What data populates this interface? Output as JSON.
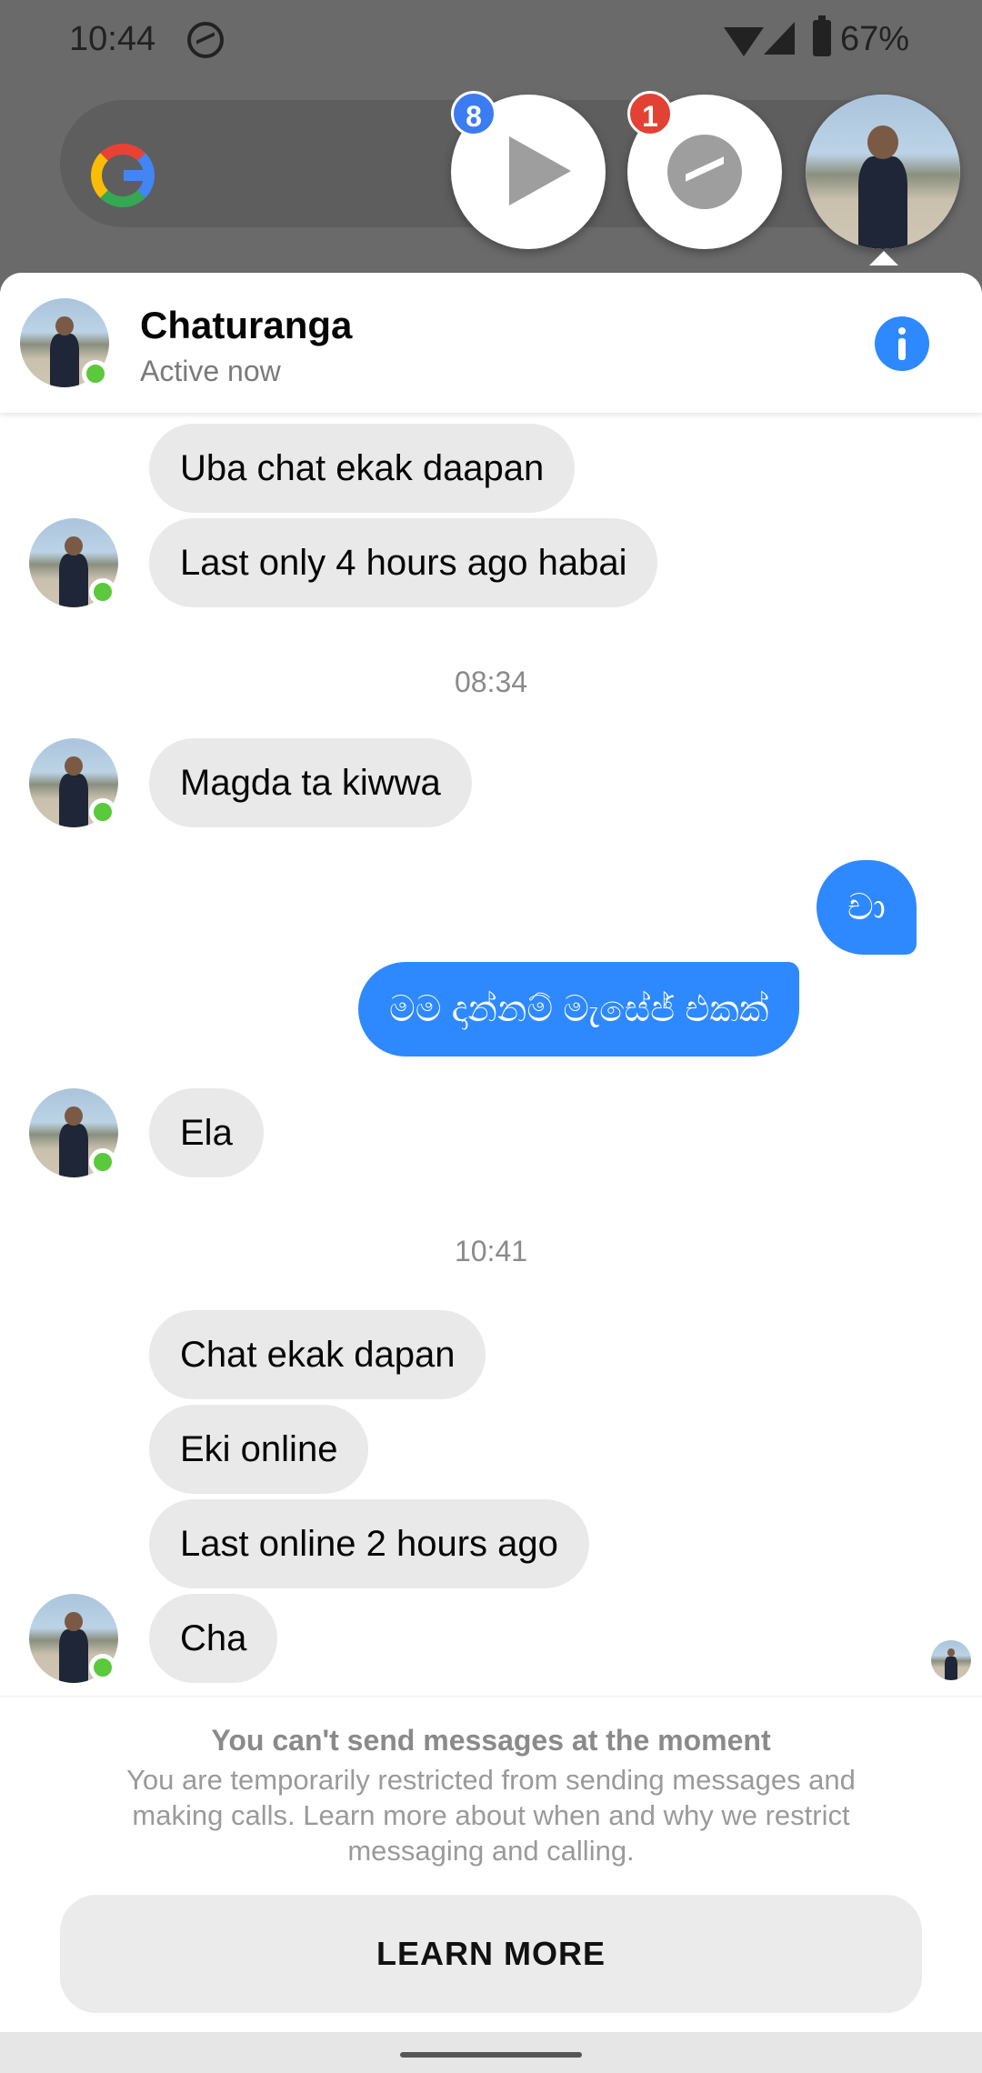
{
  "status_bar": {
    "time": "10:44",
    "battery": "67%"
  },
  "chat_heads": {
    "play_badge": "8",
    "messenger_badge": "1"
  },
  "header": {
    "name": "Chaturanga",
    "status": "Active now"
  },
  "messages": {
    "partner_1": [
      "Uba chat ekak daapan",
      "Last only 4 hours ago habai"
    ],
    "time_1": "08:34",
    "partner_2": "Magda ta kiwwa",
    "self_1": "චා",
    "self_2": "මම දාන්නම් මැසේජ් එකක්",
    "partner_3": "Ela",
    "time_2": "10:41",
    "partner_4": [
      "Chat ekak dapan",
      "Eki online",
      "Last online 2 hours ago",
      "Cha"
    ]
  },
  "footer": {
    "title": "You can't send messages at the moment",
    "description": "You are temporarily restricted from sending messages and making calls. Learn more about when and why we restrict messaging and calling.",
    "button": "LEARN MORE"
  },
  "colors": {
    "accent": "#2e89ff",
    "online": "#5ac93b",
    "badge_blue": "#3b7cf0",
    "badge_red": "#e34133"
  }
}
